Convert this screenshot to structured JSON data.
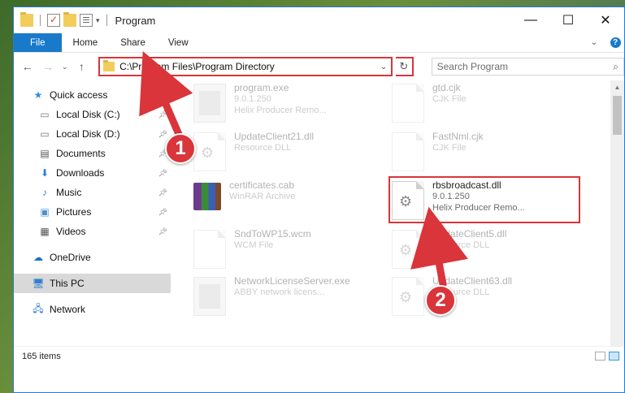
{
  "window": {
    "title": "Program",
    "controls": {
      "minimize": "—",
      "maximize": "☐",
      "close": "✕"
    }
  },
  "ribbon": {
    "tabs": [
      "File",
      "Home",
      "Share",
      "View"
    ]
  },
  "navigation": {
    "address": "C:\\Program Files\\Program Directory",
    "search_placeholder": "Search Program"
  },
  "sidebar": {
    "quick_access": "Quick access",
    "items": [
      {
        "label": "Local Disk (C:)",
        "icon": "drive-icon",
        "pinned": true
      },
      {
        "label": "Local Disk (D:)",
        "icon": "drive-icon",
        "pinned": true
      },
      {
        "label": "Documents",
        "icon": "documents-icon",
        "pinned": true
      },
      {
        "label": "Downloads",
        "icon": "download-icon",
        "pinned": true
      },
      {
        "label": "Music",
        "icon": "music-icon",
        "pinned": true
      },
      {
        "label": "Pictures",
        "icon": "pictures-icon",
        "pinned": true
      },
      {
        "label": "Videos",
        "icon": "videos-icon",
        "pinned": true
      }
    ],
    "onedrive": "OneDrive",
    "this_pc": "This PC",
    "network": "Network"
  },
  "files": [
    {
      "name": "program.exe",
      "line2": "9.0.1.250",
      "line3": "Helix Producer Remo...",
      "icon": "exe-icon",
      "faded": true
    },
    {
      "name": "gtd.cjk",
      "line2": "CJK File",
      "line3": "",
      "icon": "document-icon",
      "faded": true
    },
    {
      "name": "UpdateClient21.dll",
      "line2": "Resource DLL",
      "line3": "",
      "icon": "dll-icon",
      "faded": true
    },
    {
      "name": "FastNml.cjk",
      "line2": "CJK File",
      "line3": "",
      "icon": "document-icon",
      "faded": true
    },
    {
      "name": "certificates.cab",
      "line2": "WinRAR Archive",
      "line3": "",
      "icon": "winrar-icon",
      "faded": true
    },
    {
      "name": "rbsbroadcast.dll",
      "line2": "9.0.1.250",
      "line3": "Helix Producer Remo...",
      "icon": "dll-icon",
      "faded": false
    },
    {
      "name": "SndToWP15.wcm",
      "line2": "WCM File",
      "line3": "",
      "icon": "document-icon",
      "faded": true
    },
    {
      "name": "UpdateClient5.dll",
      "line2": "Resource DLL",
      "line3": "",
      "icon": "dll-icon",
      "faded": true
    },
    {
      "name": "NetworkLicenseServer.exe",
      "line2": "ABBY network licens...",
      "line3": "",
      "icon": "exe-icon",
      "faded": true
    },
    {
      "name": "UpdateClient63.dll",
      "line2": "Resource DLL",
      "line3": "",
      "icon": "dll-icon",
      "faded": true
    }
  ],
  "status": {
    "item_count": "165 items"
  },
  "annotations": {
    "step1": "1",
    "step2": "2",
    "color": "#d9353a"
  }
}
